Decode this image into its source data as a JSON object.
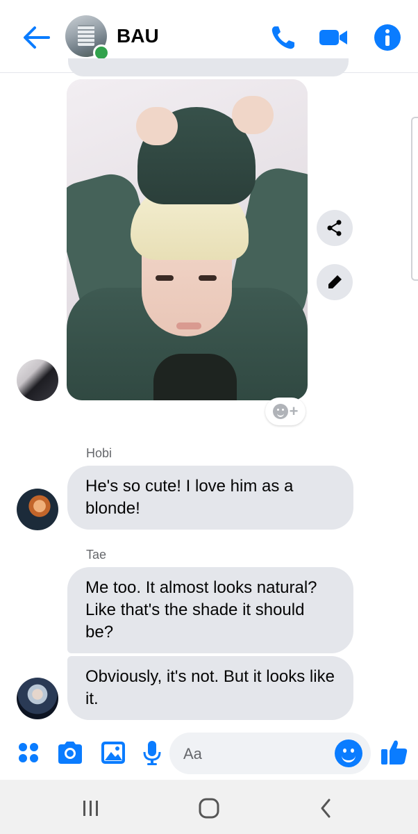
{
  "header": {
    "title": "BAU",
    "back_icon": "arrow-left-icon",
    "call_icon": "phone-icon",
    "video_icon": "video-camera-icon",
    "info_icon": "info-icon",
    "accent": "#0a7cff",
    "online_color": "#31a24c"
  },
  "messages": [
    {
      "type": "image",
      "sender": "",
      "description_icon": "photo-message"
    },
    {
      "type": "text",
      "sender": "Hobi",
      "text": "He's so cute! I love him as a blonde!"
    },
    {
      "type": "text",
      "sender": "Tae",
      "text": "Me too. It almost looks natural? Like that's the shade it should be?"
    },
    {
      "type": "text",
      "sender": "",
      "text": "Obviously, it's not. But it looks like it."
    }
  ],
  "image_actions": {
    "share_icon": "share-icon",
    "edit_icon": "pencil-icon"
  },
  "reaction": {
    "icon": "add-reaction-icon"
  },
  "composer": {
    "placeholder": "Aa",
    "icons": [
      "apps-icon",
      "camera-icon",
      "gallery-icon",
      "microphone-icon",
      "emoji-icon",
      "thumbs-up-icon"
    ]
  },
  "system_nav": {
    "icons": [
      "recent-apps-icon",
      "home-icon",
      "back-icon"
    ]
  }
}
